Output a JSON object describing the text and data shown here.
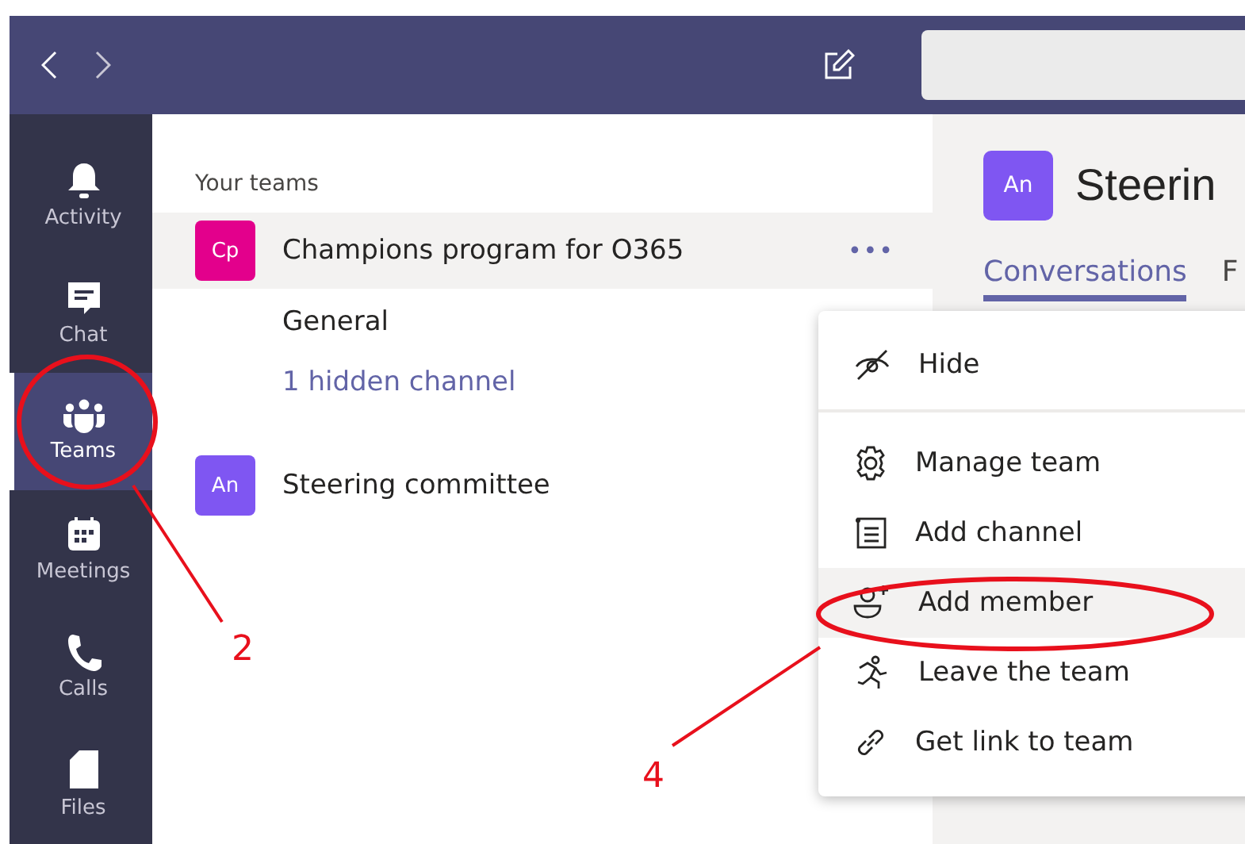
{
  "rail": {
    "items": [
      {
        "label": "Activity",
        "kind": "bell",
        "selected": false
      },
      {
        "label": "Chat",
        "kind": "chat",
        "selected": false
      },
      {
        "label": "Teams",
        "kind": "teams",
        "selected": true
      },
      {
        "label": "Meetings",
        "kind": "calendar",
        "selected": false
      },
      {
        "label": "Calls",
        "kind": "phone",
        "selected": false
      },
      {
        "label": "Files",
        "kind": "file",
        "selected": false
      }
    ]
  },
  "team_list": {
    "heading": "Your teams",
    "teams": [
      {
        "initials": "Cp",
        "name": "Champions program for O365",
        "color": "#e3008c",
        "selected": true,
        "more": "•••",
        "channels": [
          {
            "name": "General",
            "kind": "channel"
          },
          {
            "name": "1 hidden channel",
            "kind": "link"
          }
        ]
      },
      {
        "initials": "An",
        "name": "Steering committee",
        "color": "#7f56f2",
        "selected": false
      }
    ]
  },
  "team_pane": {
    "initials": "An",
    "title": "Steerin",
    "tabs": [
      {
        "label": "Conversations",
        "selected": true
      },
      {
        "label": "F",
        "selected": false
      }
    ]
  },
  "menu": {
    "sections": [
      [
        {
          "label": "Hide",
          "kind": "hide",
          "selected": false
        }
      ],
      [
        {
          "label": "Manage team",
          "kind": "gear",
          "selected": false
        },
        {
          "label": "Add channel",
          "kind": "channel",
          "selected": false
        },
        {
          "label": "Add member",
          "kind": "member",
          "selected": true
        },
        {
          "label": "Leave the team",
          "kind": "leave",
          "selected": false
        },
        {
          "label": "Get link to team",
          "kind": "link",
          "selected": false
        }
      ]
    ]
  },
  "annotations": [
    {
      "label": "2"
    },
    {
      "label": "4"
    }
  ]
}
